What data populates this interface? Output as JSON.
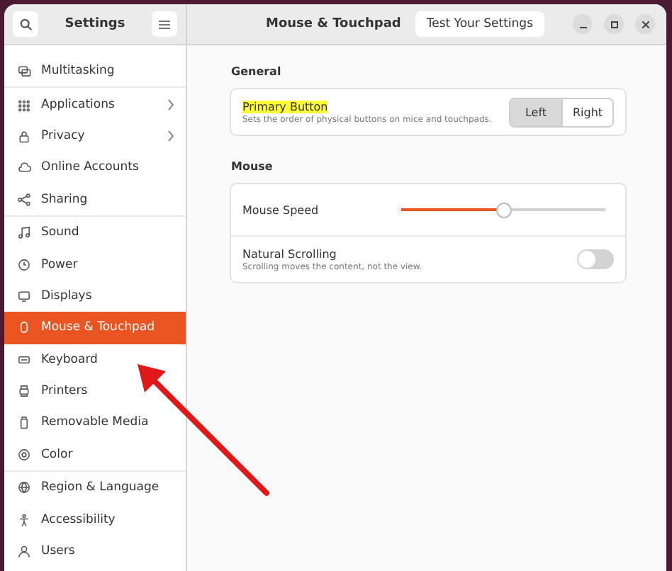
{
  "header": {
    "sidebar_title": "Settings",
    "title": "Mouse & Touchpad",
    "test_button": "Test Your Settings"
  },
  "sidebar": {
    "groups": [
      {
        "items": [
          {
            "label": "Multitasking",
            "chevron": false,
            "selected": false
          }
        ]
      },
      {
        "items": [
          {
            "label": "Applications",
            "chevron": true,
            "selected": false
          },
          {
            "label": "Privacy",
            "chevron": true,
            "selected": false
          },
          {
            "label": "Online Accounts",
            "chevron": false,
            "selected": false
          },
          {
            "label": "Sharing",
            "chevron": false,
            "selected": false
          }
        ]
      },
      {
        "items": [
          {
            "label": "Sound",
            "chevron": false,
            "selected": false
          },
          {
            "label": "Power",
            "chevron": false,
            "selected": false
          },
          {
            "label": "Displays",
            "chevron": false,
            "selected": false
          },
          {
            "label": "Mouse & Touchpad",
            "chevron": false,
            "selected": true
          },
          {
            "label": "Keyboard",
            "chevron": false,
            "selected": false
          },
          {
            "label": "Printers",
            "chevron": false,
            "selected": false
          },
          {
            "label": "Removable Media",
            "chevron": false,
            "selected": false
          },
          {
            "label": "Color",
            "chevron": false,
            "selected": false
          }
        ]
      },
      {
        "items": [
          {
            "label": "Region & Language",
            "chevron": false,
            "selected": false
          },
          {
            "label": "Accessibility",
            "chevron": false,
            "selected": false
          },
          {
            "label": "Users",
            "chevron": false,
            "selected": false
          }
        ]
      }
    ]
  },
  "general": {
    "heading": "General",
    "primary_button": {
      "title": "Primary Button",
      "highlighted": true,
      "description": "Sets the order of physical buttons on mice and touchpads.",
      "options": [
        {
          "label": "Left",
          "selected": true
        },
        {
          "label": "Right",
          "selected": false
        }
      ]
    }
  },
  "mouse": {
    "heading": "Mouse",
    "speed": {
      "label": "Mouse Speed",
      "level": 0.5
    },
    "natural_scrolling": {
      "title": "Natural Scrolling",
      "description": "Scrolling moves the content, not the view.",
      "on": false
    }
  }
}
